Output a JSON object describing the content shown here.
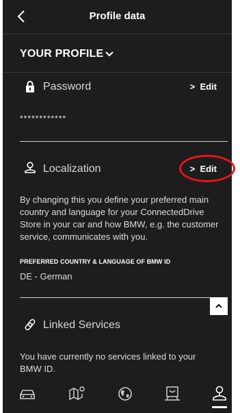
{
  "header": {
    "title": "Profile data"
  },
  "profile_section": {
    "label": "YOUR PROFILE"
  },
  "password": {
    "label": "Password",
    "edit_label": "Edit",
    "masked_value": "************"
  },
  "localization": {
    "label": "Localization",
    "edit_label": "Edit",
    "description": "By changing this you define your preferred main country and language for your ConnectedDrive Store in your car and how BMW, e.g. the customer service, communicates with you.",
    "preference_label": "PREFERRED COUNTRY & LANGUAGE OF BMW ID",
    "preference_value": "DE - German"
  },
  "linked_services": {
    "label": "Linked Services",
    "description": "You have currently no services linked to your BMW ID."
  },
  "bottom_nav": {
    "items": [
      "car-icon",
      "map-icon",
      "globe-icon",
      "store-icon",
      "profile-icon"
    ],
    "active": "profile-icon"
  },
  "colors": {
    "background": "#1d1d1d",
    "annotation": "#e8141a"
  }
}
